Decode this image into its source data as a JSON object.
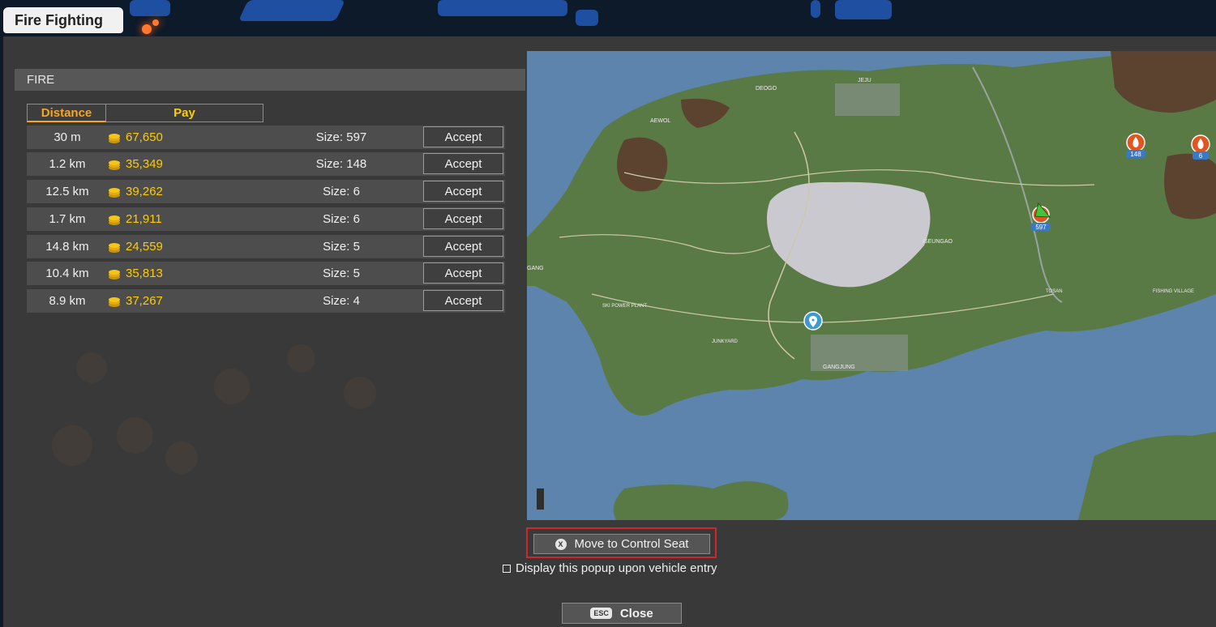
{
  "window": {
    "title": "Fire Fighting"
  },
  "section": {
    "title": "FIRE"
  },
  "table": {
    "headers": {
      "distance": "Distance",
      "pay": "Pay"
    },
    "accept_label": "Accept",
    "rows": [
      {
        "distance": "30 m",
        "pay": "67,650",
        "size": "Size: 597"
      },
      {
        "distance": "1.2 km",
        "pay": "35,349",
        "size": "Size: 148"
      },
      {
        "distance": "12.5 km",
        "pay": "39,262",
        "size": "Size: 6"
      },
      {
        "distance": "1.7 km",
        "pay": "21,911",
        "size": "Size: 6"
      },
      {
        "distance": "14.8 km",
        "pay": "24,559",
        "size": "Size: 5"
      },
      {
        "distance": "10.4 km",
        "pay": "35,813",
        "size": "Size: 5"
      },
      {
        "distance": "8.9 km",
        "pay": "37,267",
        "size": "Size: 4"
      }
    ]
  },
  "map": {
    "labels": [
      "AEWOL",
      "DEOGO",
      "JEJU",
      "ISEUNGAO",
      "GANGJUNG",
      "TOSAN",
      "FISHING VILLAGE",
      "JUNKYARD",
      "SKI POWER PLANT",
      "GANG"
    ],
    "markers": [
      {
        "icon": "fire-icon",
        "label": "148"
      },
      {
        "icon": "fire-icon",
        "label": "6"
      },
      {
        "icon": "player-vehicle-icon",
        "label": "597"
      },
      {
        "icon": "location-pin-icon",
        "label": ""
      }
    ]
  },
  "footer": {
    "control_key": "X",
    "control_seat_label": "Move to Control Seat",
    "checkbox_label": "Display this popup upon vehicle entry",
    "close_key": "ESC",
    "close_label": "Close"
  },
  "colors": {
    "accent_orange": "#f5a623",
    "pay_yellow": "#ffcc00",
    "highlight_red": "#d0262c"
  }
}
